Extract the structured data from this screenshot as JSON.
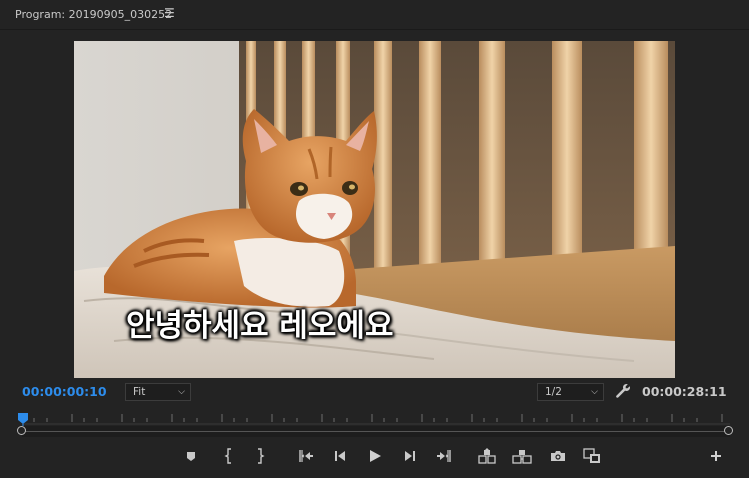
{
  "panel": {
    "title": "Program: 20190905_030252",
    "menu_icon": "hamburger-menu-icon"
  },
  "video": {
    "subtitle": "안녕하세요 레오에요"
  },
  "controls": {
    "current_timecode": "00:00:00:10",
    "duration_timecode": "00:00:28:11",
    "zoom_selected": "Fit",
    "resolution_selected": "1/2",
    "settings_icon": "wrench-icon"
  },
  "transport_buttons": [
    "add-marker-icon",
    "mark-in-icon",
    "mark-out-icon",
    "go-to-in-icon",
    "step-back-icon",
    "play-icon",
    "step-forward-icon",
    "go-to-out-icon",
    "lift-icon",
    "extract-icon",
    "export-frame-icon",
    "comparison-view-icon",
    "button-editor-icon"
  ],
  "colors": {
    "background": "#232323",
    "timecode_accent": "#2d8ceb",
    "text": "#c9c9c9"
  }
}
